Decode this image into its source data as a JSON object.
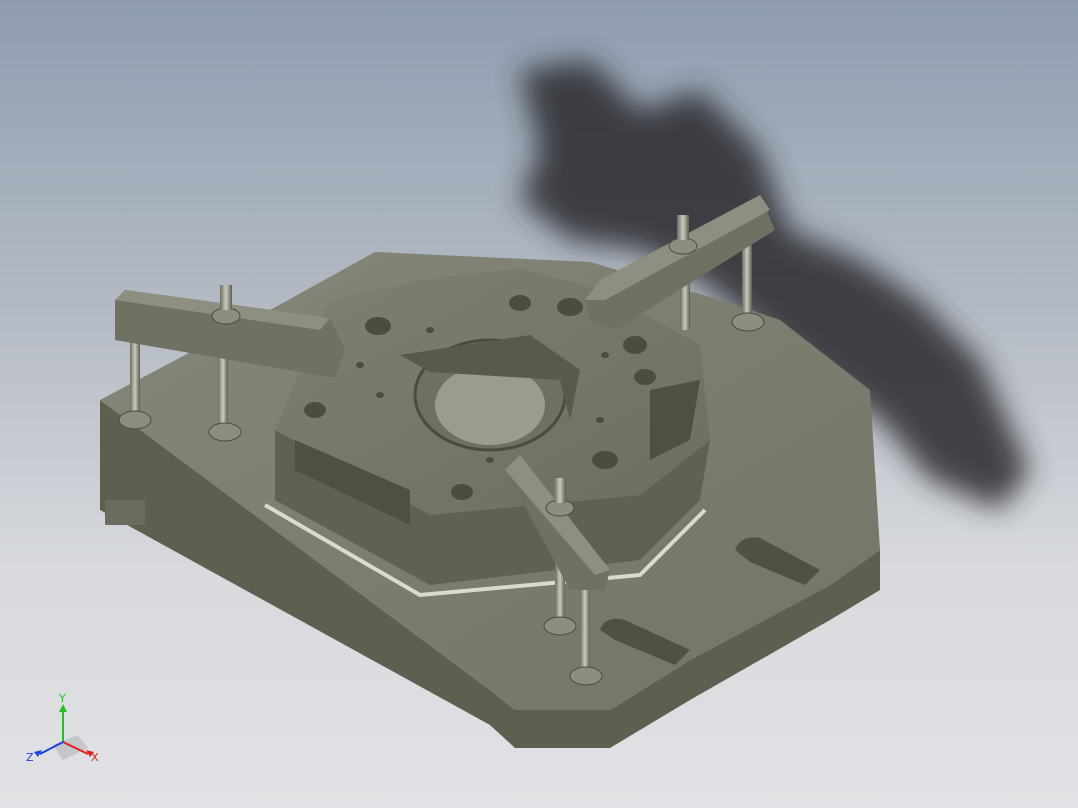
{
  "triad": {
    "x_label": "X",
    "y_label": "Y",
    "z_label": "Z",
    "x_color": "#e02020",
    "y_color": "#20c020",
    "z_color": "#2040e0"
  },
  "colors": {
    "background_top": "#8f9db0",
    "background_bottom": "#e1e2e5",
    "part_face": "#7b7d6e",
    "part_side": "#5e604f",
    "shadow": "#2a2c2f"
  }
}
